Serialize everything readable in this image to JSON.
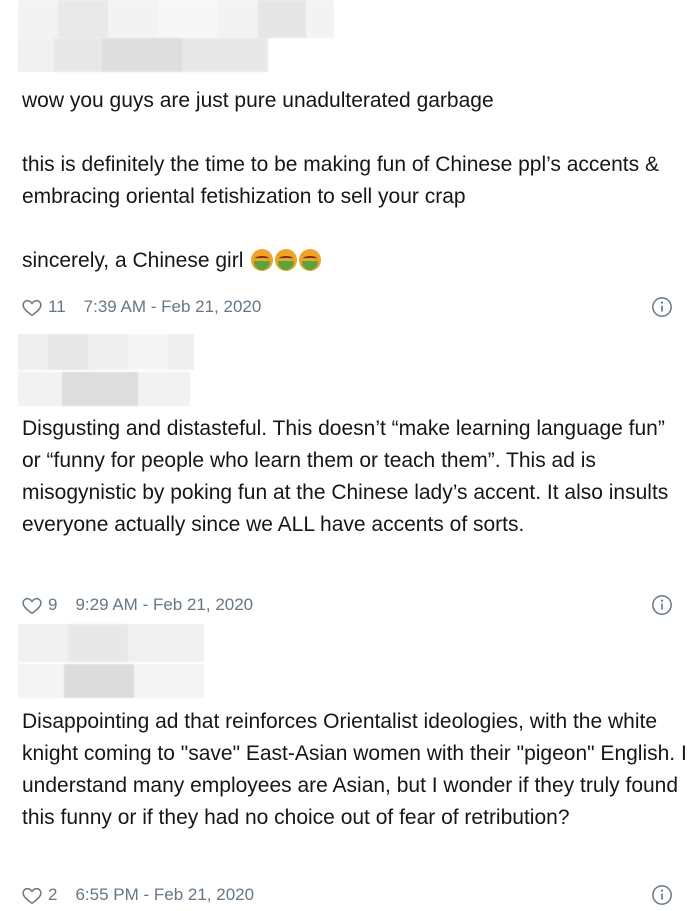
{
  "tweets": [
    {
      "paragraphs": [
        "wow you guys are just pure unadulterated garbage",
        "this is definitely the time to be making fun of Chinese ppl’s accents & embracing oriental fetishization to sell your crap",
        "sincerely, a Chinese girl"
      ],
      "emoji": [
        "face-vomiting-emoji",
        "face-vomiting-emoji",
        "face-vomiting-emoji"
      ],
      "likes": "11",
      "timestamp": "7:39 AM - Feb 21, 2020"
    },
    {
      "paragraphs": [
        "Disgusting and distasteful. This doesn’t “make learning language fun” or “funny for people who learn them or teach them”. This ad is misogynistic by poking fun at the Chinese lady’s accent. It also insults everyone actually since we ALL have accents of sorts."
      ],
      "likes": "9",
      "timestamp": "9:29 AM - Feb 21, 2020"
    },
    {
      "paragraphs": [
        "Disappointing ad that reinforces Orientalist ideologies, with the white knight coming to \"save\" East-Asian women with their \"pigeon\" English. I understand many employees are Asian, but I wonder if they truly found this funny or if they had no choice out of fear of retribution?"
      ],
      "likes": "2",
      "timestamp": "6:55 PM - Feb 21, 2020"
    }
  ],
  "icons": {
    "like": "heart-outline-icon",
    "info": "info-circle-icon"
  },
  "colors": {
    "text": "#14171a",
    "meta": "#657786",
    "redaction": "#ececec"
  }
}
